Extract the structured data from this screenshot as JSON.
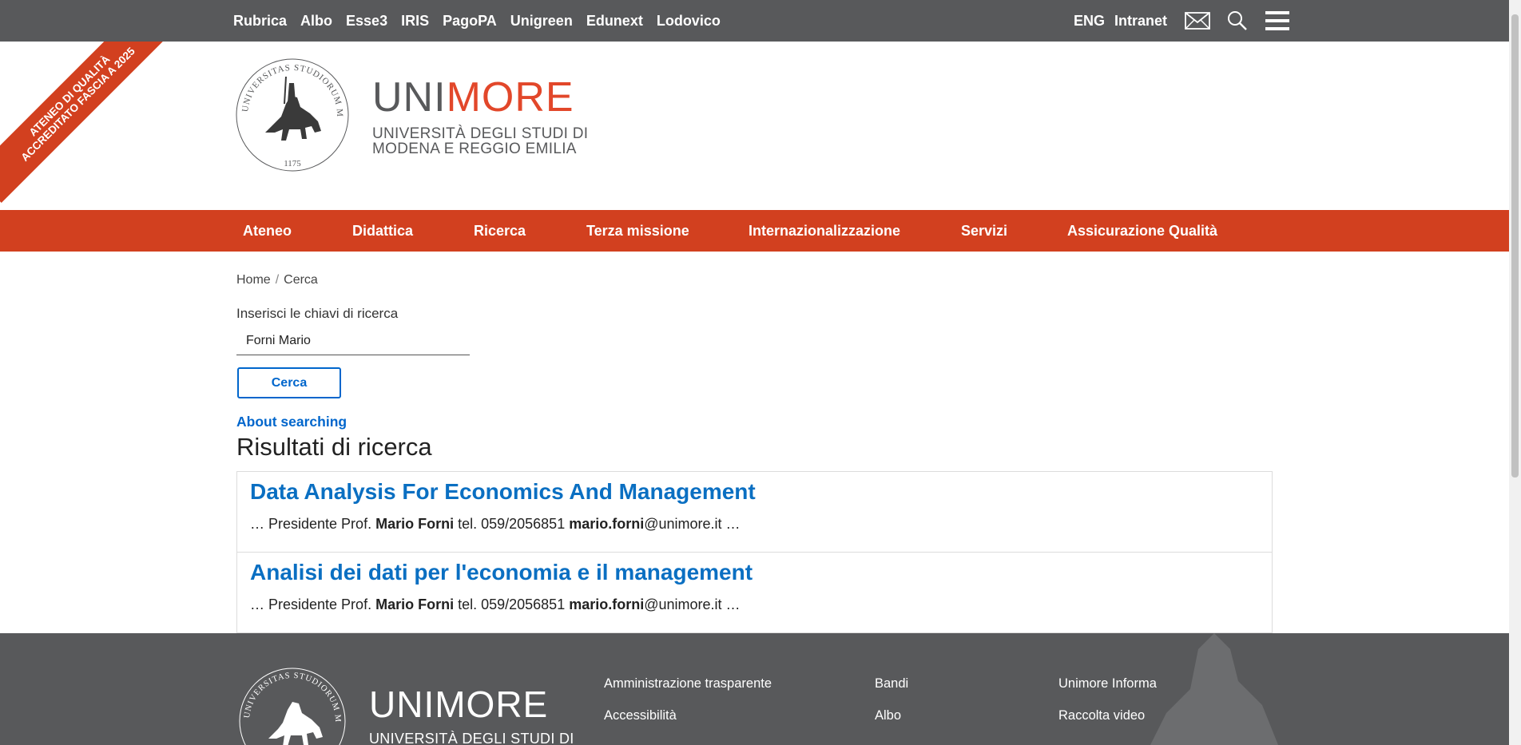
{
  "top_links": [
    "Rubrica",
    "Albo",
    "Esse3",
    "IRIS",
    "PagoPA",
    "Unigreen",
    "Edunext",
    "Lodovico"
  ],
  "top_right": {
    "lang": "ENG",
    "intranet": "Intranet",
    "icons": [
      "mail-icon",
      "search-icon",
      "menu-icon"
    ]
  },
  "ribbon": {
    "line1": "ATENEO DI QUALITÀ",
    "line2": "ACCREDITATO FASCIA A 2025"
  },
  "brand": {
    "name_part1": "UNI",
    "name_part2": "MORE",
    "sub_line1": "UNIVERSITÀ DEGLI STUDI DI",
    "sub_line2": "MODENA E REGGIO EMILIA",
    "seal_text": "UNIVERSITAS STUDIORUM MUTINENSIS ET REGIENSIS",
    "seal_year": "1175"
  },
  "main_nav": [
    "Ateneo",
    "Didattica",
    "Ricerca",
    "Terza missione",
    "Internazionalizzazione",
    "Servizi",
    "Assicurazione Qualità"
  ],
  "breadcrumb": {
    "home": "Home",
    "separator": "/",
    "current": "Cerca"
  },
  "search": {
    "label": "Inserisci le chiavi di ricerca",
    "value": "Forni Mario",
    "button": "Cerca",
    "about": "About searching"
  },
  "results_title": "Risultati di ricerca",
  "results": [
    {
      "title": "Data Analysis For Economics And Management",
      "snippet_pre": "… Presidente Prof. ",
      "snippet_b1": "Mario Forni",
      "snippet_mid": " tel. 059/2056851 ",
      "snippet_b2": "mario.forni",
      "snippet_post": "@unimore.it …"
    },
    {
      "title": "Analisi dei dati per l'economia e il management",
      "snippet_pre": "… Presidente Prof. ",
      "snippet_b1": "Mario Forni",
      "snippet_mid": " tel. 059/2056851 ",
      "snippet_b2": "mario.forni",
      "snippet_post": "@unimore.it …"
    }
  ],
  "footer": {
    "brand_name": "UNIMORE",
    "brand_sub": "UNIVERSITÀ DEGLI STUDI DI",
    "col1": [
      "Amministrazione trasparente",
      "Accessibilità"
    ],
    "col2": [
      "Bandi",
      "Albo"
    ],
    "col3": [
      "Unimore Informa",
      "Raccolta video"
    ]
  },
  "colors": {
    "topbar": "#58595b",
    "accent": "#d2401f",
    "link": "#0066cc",
    "brand_more": "#e2472a"
  }
}
